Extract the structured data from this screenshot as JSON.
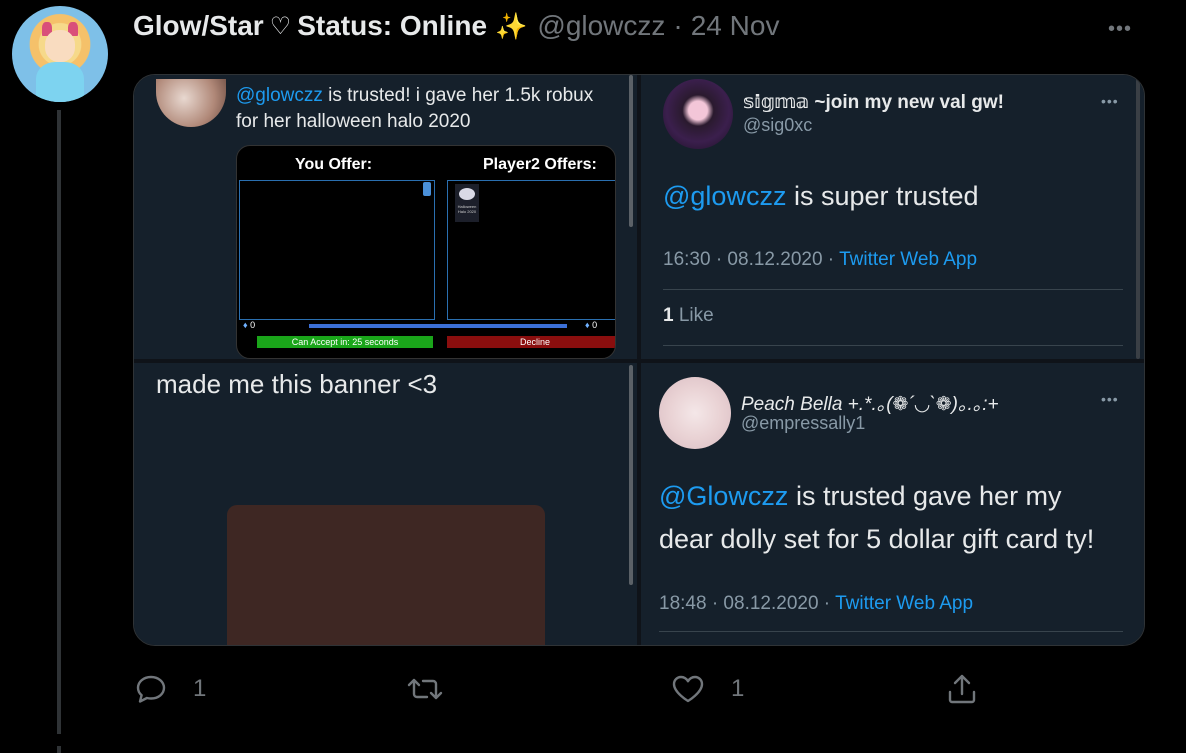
{
  "tweet": {
    "display_name": "Glow/Star",
    "heart_glyph": "♡",
    "status_text": "Status: Online",
    "sparkle_glyph": "✨",
    "handle": "@glowczz",
    "separator": "·",
    "date": "24 Nov",
    "more_glyph": "•••"
  },
  "media": {
    "cell_a": {
      "mention": "@glowczz",
      "text": " is trusted! i gave her 1.5k robux for her halloween halo 2020",
      "trade": {
        "you_offer": "You Offer:",
        "player2_offers": "Player2 Offers:",
        "item_name": "Halloween Halo 2020",
        "robux_left": "0",
        "robux_right": "0",
        "accept_label": "Can Accept in: 25 seconds",
        "decline_label": "Decline"
      }
    },
    "cell_b": {
      "name": "𝕤𝕚𝕘𝕞𝕒 ~join my new val gw!",
      "handle": "@sig0xc",
      "mention": "@glowczz",
      "body": " is super trusted",
      "time": "16:30 · 08.12.2020",
      "dot": " · ",
      "app": "Twitter Web App",
      "likes_count": "1",
      "likes_label": " Like",
      "more_glyph": "•••"
    },
    "cell_c": {
      "text": "made me this banner <3"
    },
    "cell_d": {
      "name": "Peach Bella +.*.｡(❁´◡`❁)｡.｡:+",
      "handle": "@empressally1",
      "mention": "@Glowczz",
      "body_line1": " is trusted gave her my",
      "body_line2": "dear dolly set for 5 dollar gift card ty!",
      "time": "18:48 · 08.12.2020",
      "dot": " · ",
      "app": "Twitter Web App",
      "more_glyph": "•••"
    }
  },
  "actions": {
    "reply_count": "1",
    "retweet_count": "",
    "like_count": "1"
  },
  "colors": {
    "background": "#000000",
    "card": "#15202b",
    "accent": "#1d9bf0",
    "muted": "#71767b",
    "accept_green": "#1aa51a",
    "decline_red": "#8a0e0e"
  }
}
